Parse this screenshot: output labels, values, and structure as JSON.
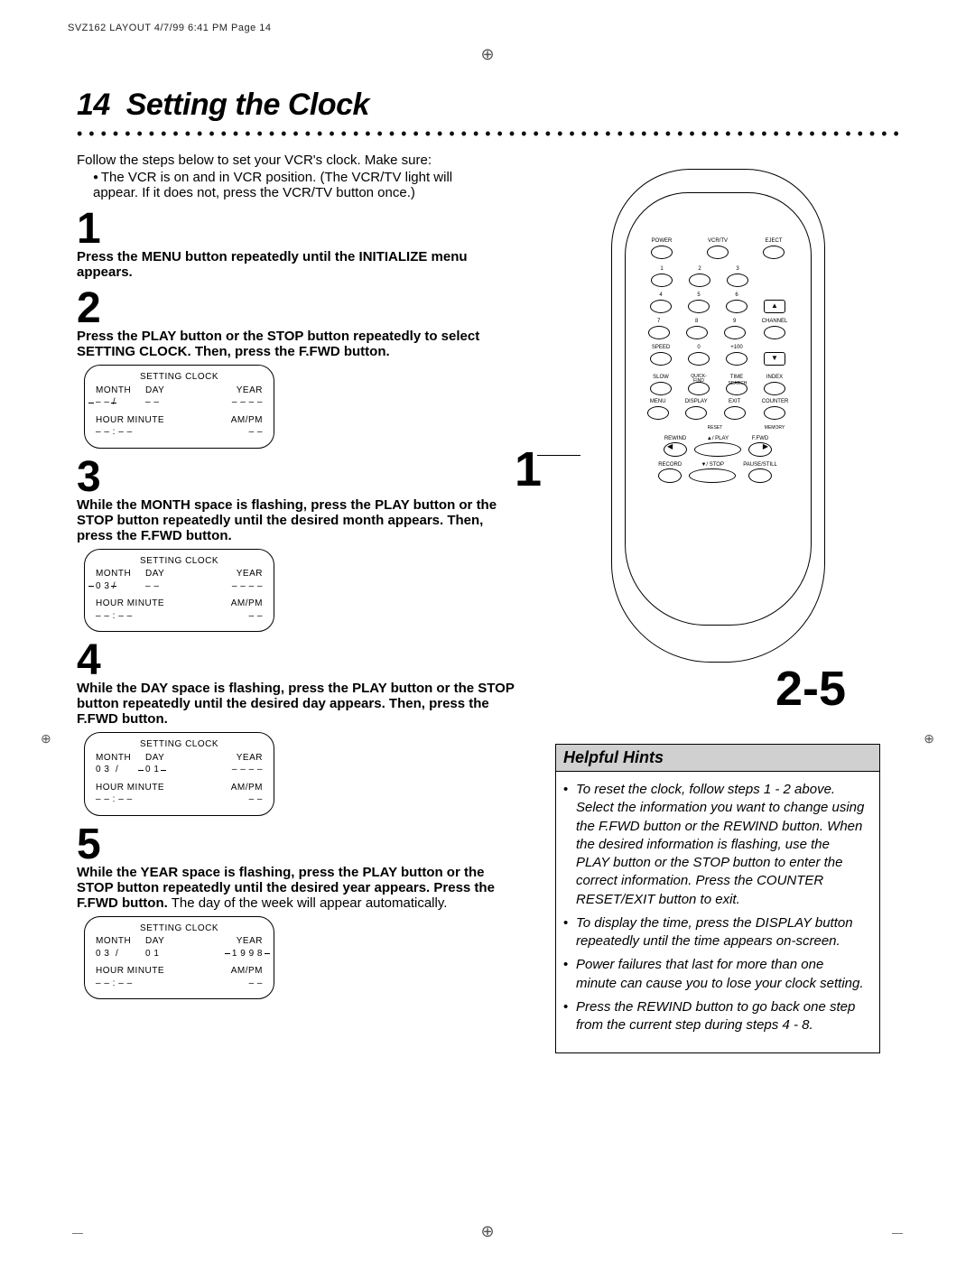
{
  "slug": "SVZ162 LAYOUT  4/7/99 6:41 PM  Page 14",
  "page_number": "14",
  "page_title": "Setting the Clock",
  "intro": "Follow the steps below to set your VCR's clock.  Make sure:",
  "bullet1a": "The VCR is on and in VCR position. (The VCR/TV light will",
  "bullet1b": "appear. If it does not, press the VCR/TV button once.)",
  "steps": {
    "s1": {
      "num": "1",
      "text": "Press the MENU button repeatedly until the INITIALIZE menu appears."
    },
    "s2": {
      "num": "2",
      "text": "Press the PLAY button or the STOP button repeatedly to select SETTING CLOCK. Then, press the F.FWD button."
    },
    "s3": {
      "num": "3",
      "text": "While the MONTH space is flashing, press the PLAY button or the STOP button repeatedly until the desired month appears. Then, press the F.FWD button."
    },
    "s4": {
      "num": "4",
      "text": "While the DAY space is flashing, press the PLAY button or the STOP button repeatedly until the desired day appears. Then, press the F.FWD button."
    },
    "s5": {
      "num": "5",
      "textBold": "While the YEAR space is flashing, press the PLAY button or the STOP button repeatedly until the desired year appears. Press the F.FWD button.",
      "textNormal": " The day of the week will appear automatically."
    }
  },
  "osd": {
    "title": "SETTING CLOCK",
    "headers": {
      "month": "MONTH",
      "day": "DAY",
      "year": "YEAR",
      "hourmin": "HOUR MINUTE",
      "ampm": "AM/PM"
    },
    "box2": {
      "month": "– –",
      "sep": "/",
      "day": "– –",
      "year": "– – – –",
      "time": "– –  :  – –",
      "ampm": "– –"
    },
    "box3": {
      "month": "0 3",
      "sep": "/",
      "day": "– –",
      "year": "– – – –",
      "time": "– –  :  – –",
      "ampm": "– –"
    },
    "box4": {
      "month": "0 3",
      "sep": "/",
      "day": "0 1",
      "year": "– – – –",
      "time": "– –  :  – –",
      "ampm": "– –"
    },
    "box5": {
      "month": "0 3",
      "sep": "/",
      "day": "0 1",
      "year": "1 9 9 8",
      "time": "– –  :  – –",
      "ampm": "– –"
    }
  },
  "remote": {
    "callout_left": "1",
    "callout_big": "2-5",
    "labels": {
      "power": "POWER",
      "vcrtv": "VCR/TV",
      "eject": "EJECT",
      "n1": "1",
      "n2": "2",
      "n3": "3",
      "n4": "4",
      "n5": "5",
      "n6": "6",
      "n7": "7",
      "n8": "8",
      "n9": "9",
      "n0": "0",
      "channel": "CHANNEL",
      "speed": "SPEED",
      "plus100": "+100",
      "slow": "SLOW",
      "quick": "QUICK-\nFIND",
      "search": "SEARCH",
      "time": "TIME",
      "index": "INDEX",
      "menu": "MENU",
      "display": "DISPLAY",
      "exit": "EXIT",
      "counter": "COUNTER",
      "reset": "RESET",
      "memory": "MEMORY",
      "rewind": "REWIND",
      "play": "▲/ PLAY",
      "ffwd": "F.FWD",
      "record": "RECORD",
      "stop": "▼/ STOP",
      "pause": "PAUSE/STILL"
    }
  },
  "hints": {
    "header": "Helpful Hints",
    "items": [
      "To reset the clock, follow steps 1 - 2 above. Select the information you want to change using the F.FWD button or the REWIND button. When the desired information is flashing, use the PLAY button or the STOP button to enter the correct information. Press the COUNTER RESET/EXIT button to exit.",
      "To display the time, press the DISPLAY button repeatedly until the time appears on-screen.",
      "Power failures that last for more than one minute can cause you to lose your clock setting.",
      "Press the REWIND button to go back one step from the current step during steps 4 - 8."
    ]
  }
}
